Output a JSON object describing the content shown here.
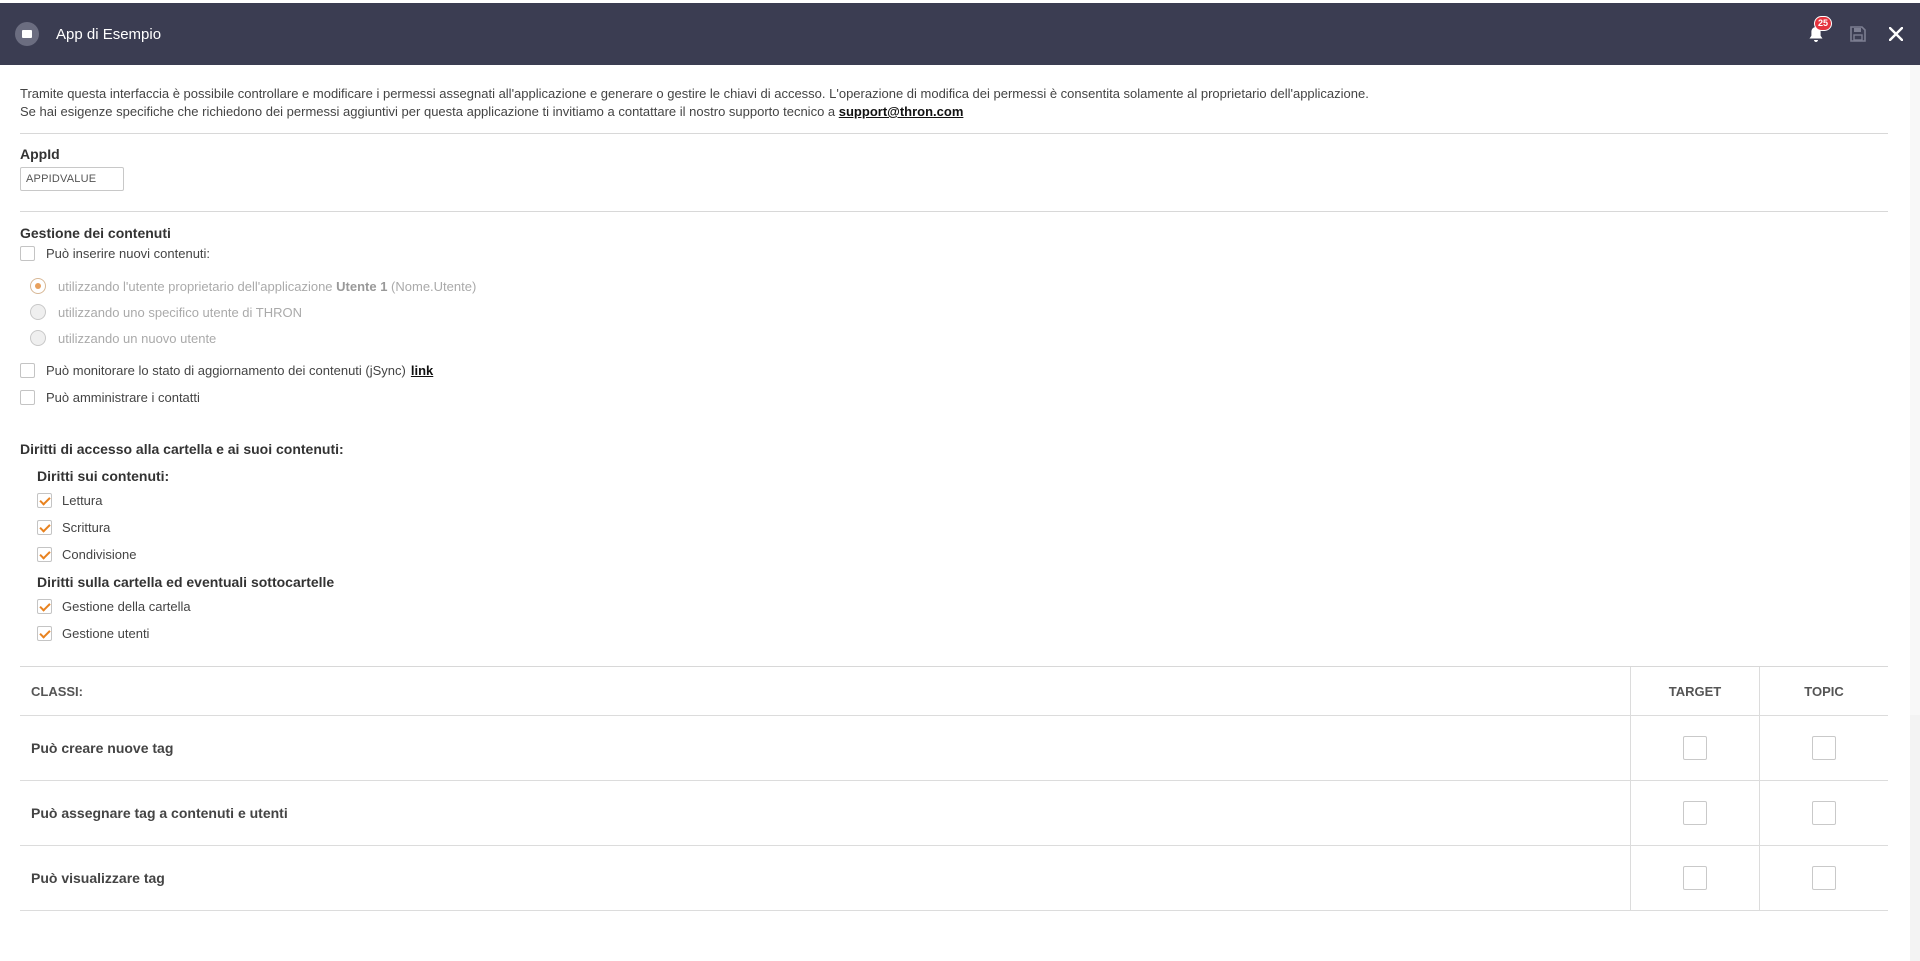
{
  "header": {
    "title": "App di Esempio",
    "notification_count": "25",
    "colors": {
      "bar": "#3b3d52",
      "badge": "#e5343f"
    }
  },
  "intro": {
    "line1": "Tramite questa interfaccia è possibile controllare e modificare i permessi assegnati all'applicazione e generare o gestire le chiavi di accesso. L'operazione di modifica dei permessi è consentita solamente al proprietario dell'applicazione.",
    "line2_prefix": "Se hai esigenze specifiche che richiedono dei permessi aggiuntivi per questa applicazione ti invitiamo a contattare il nostro supporto tecnico a ",
    "support_email": "support@thron.com"
  },
  "appid": {
    "label": "AppId",
    "value": "APPIDVALUE"
  },
  "content_management": {
    "title": "Gestione dei contenuti",
    "insert_label": "Può inserire nuovi contenuti:",
    "insert_checked": false,
    "radio_options": [
      {
        "prefix": "utilizzando l'utente proprietario dell'applicazione ",
        "bold": "Utente 1",
        "suffix": " (Nome.Utente)",
        "selected": true
      },
      {
        "prefix": "utilizzando uno specifico utente di THRON",
        "bold": "",
        "suffix": "",
        "selected": false
      },
      {
        "prefix": "utilizzando un nuovo utente",
        "bold": "",
        "suffix": "",
        "selected": false
      }
    ],
    "monitor_label": "Può monitorare lo stato di aggiornamento dei contenuti (jSync)",
    "monitor_link": "link",
    "contacts_label": "Può amministrare i contatti"
  },
  "access_rights": {
    "title": "Diritti di accesso alla cartella e ai suoi contenuti:",
    "content_rights_title": "Diritti sui contenuti:",
    "content_rights": [
      "Lettura",
      "Scrittura",
      "Condivisione"
    ],
    "folder_rights_title": "Diritti sulla cartella ed eventuali sottocartelle",
    "folder_rights": [
      "Gestione della cartella",
      "Gestione utenti"
    ],
    "check_color": "#e8821f"
  },
  "classes_table": {
    "header": [
      "CLASSI:",
      "TARGET",
      "TOPIC"
    ],
    "rows": [
      {
        "label": "Può creare nuove tag",
        "target": false,
        "topic": false
      },
      {
        "label": "Può assegnare tag a contenuti e utenti",
        "target": false,
        "topic": false
      },
      {
        "label": "Può visualizzare tag",
        "target": false,
        "topic": false
      }
    ]
  }
}
